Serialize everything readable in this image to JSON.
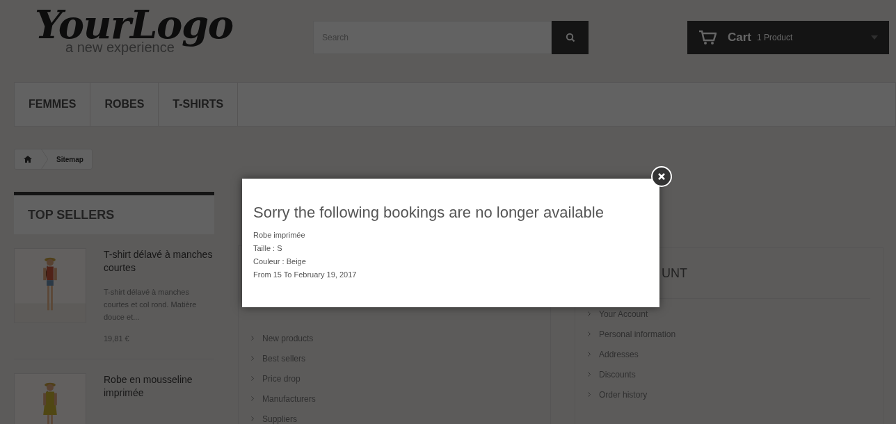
{
  "header": {
    "logo": "YourLogo",
    "tagline": "a new experience",
    "search": {
      "placeholder": "Search"
    },
    "cart": {
      "label": "Cart",
      "count": "1 Product"
    }
  },
  "nav": [
    {
      "label": "FEMMES"
    },
    {
      "label": "ROBES"
    },
    {
      "label": "T-SHIRTS"
    }
  ],
  "breadcrumb": {
    "current": "Sitemap"
  },
  "top_sellers": {
    "title": "TOP SELLERS",
    "products": [
      {
        "name": "T-shirt délavé à manches courtes",
        "description": "T-shirt délavé à manches courtes et col rond. Matière douce et...",
        "price": "19,81 €"
      },
      {
        "name": "Robe en mousseline imprimée"
      }
    ]
  },
  "sitemap_column": {
    "links": [
      "New products",
      "Best sellers",
      "Price drop",
      "Manufacturers",
      "Suppliers"
    ]
  },
  "account_column": {
    "heading_fragment": "UNT",
    "links": [
      "Your Account",
      "Personal information",
      "Addresses",
      "Discounts",
      "Order history"
    ]
  },
  "modal": {
    "title": "Sorry the following bookings are no longer available",
    "lines": [
      "Robe imprimée",
      "Taille : S",
      "Couleur : Beige",
      "From 15 To February 19, 2017"
    ]
  }
}
